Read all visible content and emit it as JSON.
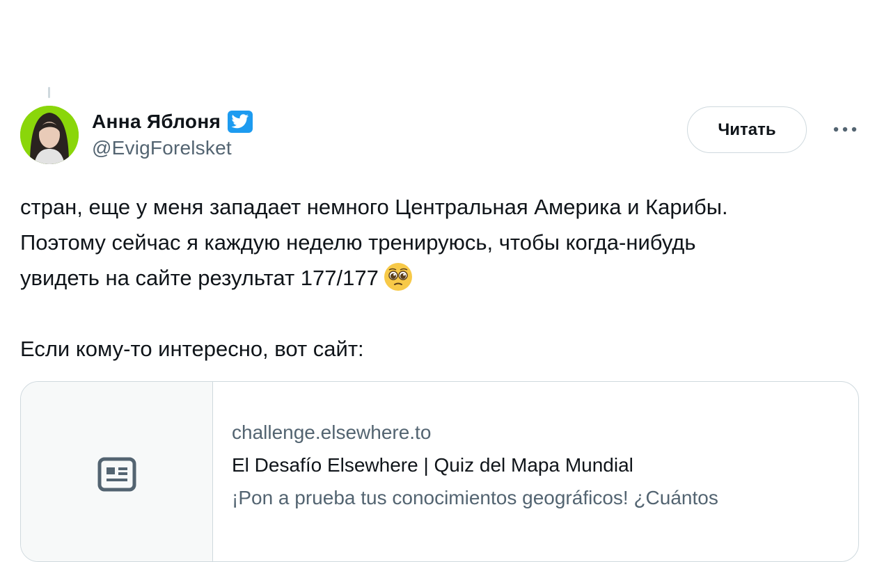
{
  "author": {
    "display_name": "Анна Яблоня",
    "handle": "@EvigForelsket",
    "verified_icon": "verified-badge-icon"
  },
  "actions": {
    "follow_label": "Читать",
    "more_icon": "more-horizontal-icon"
  },
  "tweet": {
    "lines": [
      "стран, еще у меня западает немного Центральная Америка и Карибы.",
      "Поэтому сейчас я каждую неделю тренируюсь, чтобы когда-нибудь",
      "увидеть на сайте результат 177/177"
    ],
    "emoji_icon": "pleading-face-emoji",
    "second_paragraph": "Если кому-то интересно, вот сайт:"
  },
  "link_card": {
    "thumb_icon": "article-icon",
    "domain": "challenge.elsewhere.to",
    "title": "El Desafío Elsewhere | Quiz del Mapa Mundial",
    "description": "¡Pon a prueba tus conocimientos geográficos! ¿Cuántos"
  },
  "colors": {
    "accent": "#1d9bf0",
    "text_primary": "#0f1419",
    "text_secondary": "#536471",
    "border": "#cfd9de"
  }
}
